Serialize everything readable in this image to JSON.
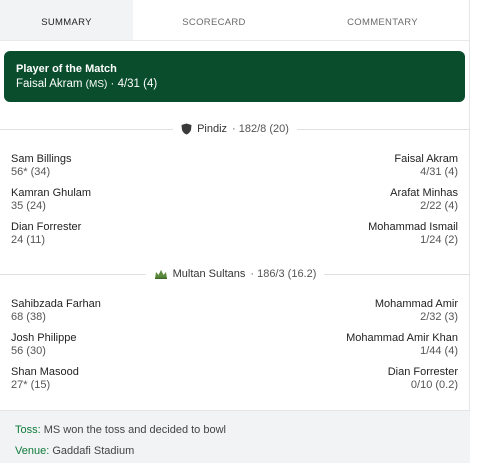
{
  "tabs": [
    "SUMMARY",
    "SCORECARD",
    "COMMENTARY"
  ],
  "potm": {
    "title": "Player of the Match",
    "player": "Faisal Akram",
    "team": "(MS)",
    "figures": "· 4/31 (4)"
  },
  "innings": [
    {
      "team": "Pindiz",
      "score": "· 182/8 (20)",
      "rows": [
        {
          "bat": "Sam Billings",
          "bat_score": "56* (34)",
          "bowl": "Faisal Akram",
          "bowl_fig": "4/31 (4)"
        },
        {
          "bat": "Kamran Ghulam",
          "bat_score": "35 (24)",
          "bowl": "Arafat Minhas",
          "bowl_fig": "2/22 (4)"
        },
        {
          "bat": "Dian Forrester",
          "bat_score": "24 (11)",
          "bowl": "Mohammad Ismail",
          "bowl_fig": "1/24 (2)"
        }
      ]
    },
    {
      "team": "Multan Sultans",
      "score": "· 186/3 (16.2)",
      "rows": [
        {
          "bat": "Sahibzada Farhan",
          "bat_score": "68 (38)",
          "bowl": "Mohammad Amir",
          "bowl_fig": "2/32 (3)"
        },
        {
          "bat": "Josh Philippe",
          "bat_score": "56 (30)",
          "bowl": "Mohammad Amir Khan",
          "bowl_fig": "1/44 (4)"
        },
        {
          "bat": "Shan Masood",
          "bat_score": "27* (15)",
          "bowl": "Dian Forrester",
          "bowl_fig": "0/10 (0.2)"
        }
      ]
    }
  ],
  "footer": {
    "toss_label": "Toss:",
    "toss_value": "MS won the toss and decided to bowl",
    "venue_label": "Venue:",
    "venue_value": "Gaddafi Stadium"
  },
  "colors": {
    "potm_bg": "#0a4d2c",
    "label_green": "#0f7a3c"
  },
  "icons": {
    "pindiz": "shield-icon",
    "multan": "team-crest-icon"
  }
}
